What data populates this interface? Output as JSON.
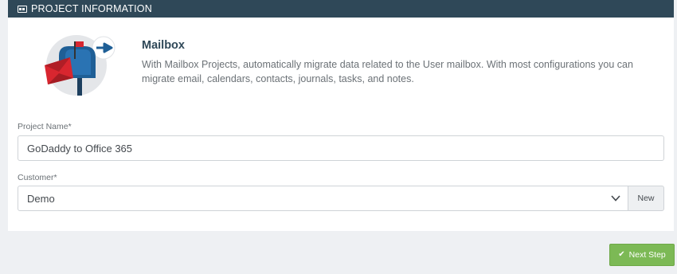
{
  "header": {
    "title": "PROJECT INFORMATION",
    "icon": "card-icon"
  },
  "project_type": {
    "title": "Mailbox",
    "description": "With Mailbox Projects, automatically migrate data related to the User mailbox. With most configurations you can migrate email, calendars, contacts, journals, tasks, and notes.",
    "icon": "mailbox-icon"
  },
  "form": {
    "project_name": {
      "label": "Project Name*",
      "value": "GoDaddy to Office 365"
    },
    "customer": {
      "label": "Customer*",
      "selected": "Demo",
      "new_label": "New"
    }
  },
  "footer": {
    "next_label": "Next Step"
  },
  "colors": {
    "header_bg": "#2f4858",
    "accent_green": "#7cb955",
    "page_bg": "#eef0f3",
    "mailbox_blue": "#1f5f96",
    "mailbox_red": "#d8262f"
  }
}
